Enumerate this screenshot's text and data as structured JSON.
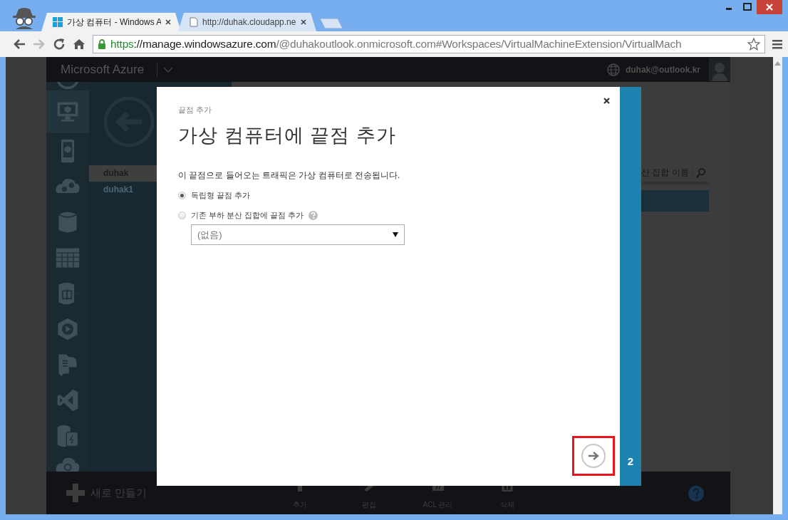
{
  "browser": {
    "tabs": [
      {
        "label": "가상 컴퓨터 - Windows A",
        "selected": true,
        "kind": "windows"
      },
      {
        "label": "http://duhak.cloudapp.ne",
        "selected": false,
        "kind": "page"
      }
    ],
    "url": {
      "scheme": "https",
      "host": "://manage.windowsazure.com",
      "path": "/@duhakoutlook.onmicrosoft.com#Workspaces/VirtualMachineExtension/VirtualMach"
    }
  },
  "portal": {
    "brand": "Microsoft Azure",
    "account": "duhak@outlook.kr",
    "nav": [
      {
        "kind": "globe",
        "selected": false
      },
      {
        "kind": "monitor",
        "selected": true
      },
      {
        "kind": "mobile",
        "selected": false
      },
      {
        "kind": "cloud-gears",
        "selected": false
      },
      {
        "kind": "database",
        "selected": false
      },
      {
        "kind": "table",
        "selected": false
      },
      {
        "kind": "database-arrow",
        "selected": false
      },
      {
        "kind": "media",
        "selected": false
      },
      {
        "kind": "document-download",
        "selected": false
      },
      {
        "kind": "studio",
        "selected": false
      },
      {
        "kind": "storage",
        "selected": false
      },
      {
        "kind": "cloud-network",
        "selected": false
      }
    ],
    "items": [
      {
        "label": "duhak",
        "selected": true
      },
      {
        "label": "duhak1",
        "selected": false
      }
    ],
    "search": {
      "placeholder": "산 집합 이름"
    },
    "new_label": "새로 만들기",
    "commands": [
      {
        "label": "추가",
        "kind": "plus"
      },
      {
        "label": "편집",
        "kind": "pencil"
      },
      {
        "label": "ACL 관리",
        "kind": "acl"
      },
      {
        "label": "삭제",
        "kind": "trash"
      }
    ]
  },
  "dialog": {
    "eyebrow": "끝점 추가",
    "title": "가상 컴퓨터에 끝점 추가",
    "description": "이 끝점으로 들어오는 트래픽은 가상 컴퓨터로 전송됩니다.",
    "options": [
      {
        "label": "독립형 끝점 추가",
        "selected": true,
        "help": false
      },
      {
        "label": "기존 부하 분산 집합에 끝점 추가",
        "selected": false,
        "help": true
      }
    ],
    "select": {
      "value": "(없음)"
    },
    "next": {
      "highlighted": true
    },
    "step": "2"
  }
}
